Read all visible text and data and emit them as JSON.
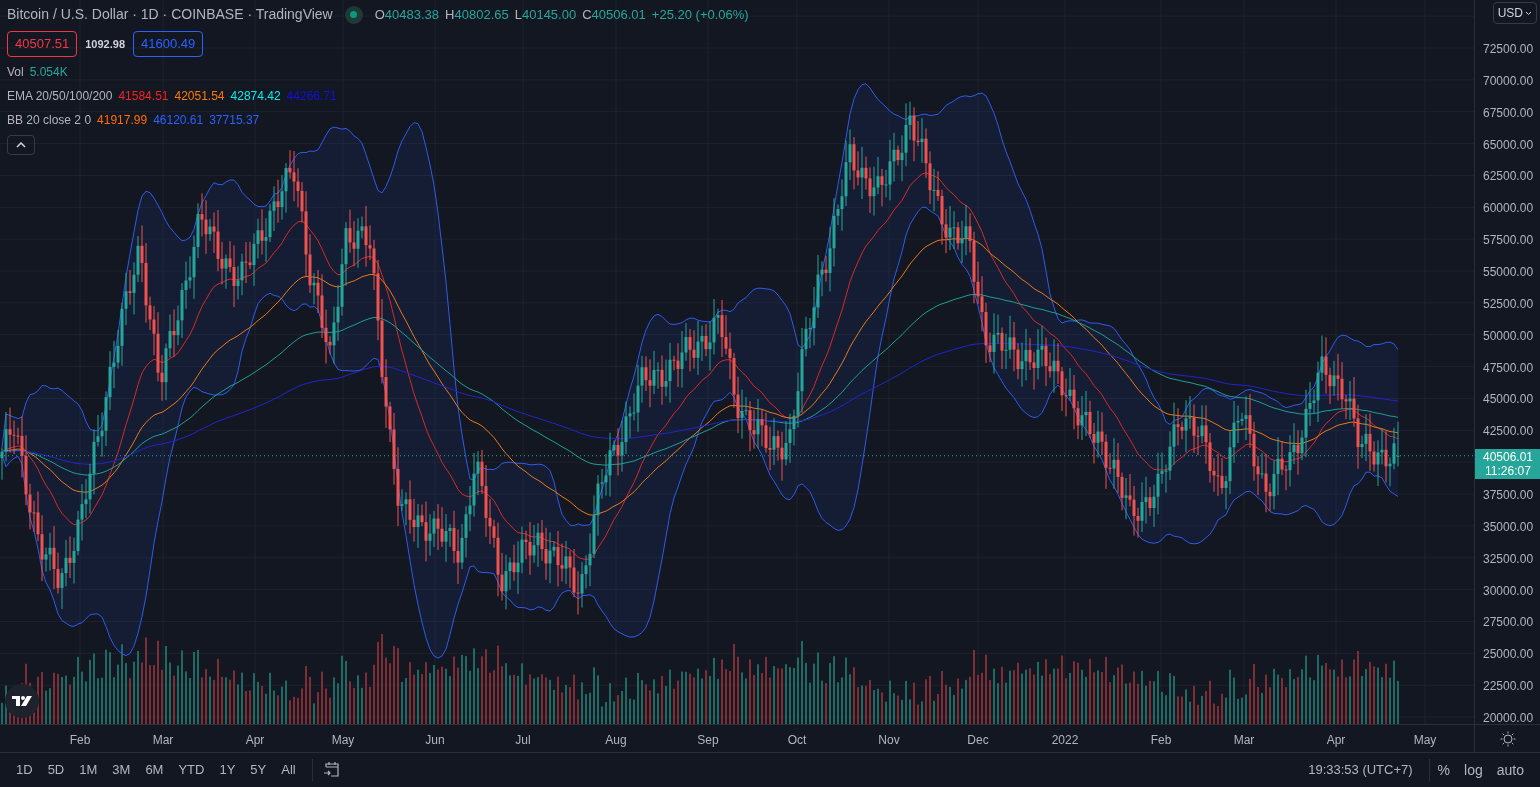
{
  "header": {
    "title": "Bitcoin / U.S. Dollar · 1D · COINBASE · TradingView",
    "ohlc": [
      {
        "label": "O",
        "value": "40483.38"
      },
      {
        "label": "H",
        "value": "40802.65"
      },
      {
        "label": "L",
        "value": "40145.00"
      },
      {
        "label": "C",
        "value": "40506.01"
      }
    ],
    "change": "+25.20 (+0.06%)"
  },
  "quote": {
    "sell": "40507.51",
    "spread": "1092.98",
    "buy": "41600.49"
  },
  "indicators": [
    {
      "name": "Vol",
      "values": [
        {
          "text": "5.054K",
          "color": "#26a69a"
        }
      ]
    },
    {
      "name": "EMA 20/50/100/200",
      "values": [
        {
          "text": "41584.51",
          "color": "#f7211e"
        },
        {
          "text": "42051.54",
          "color": "#ff7a00"
        },
        {
          "text": "42874.42",
          "color": "#00f0f0"
        },
        {
          "text": "44266.71",
          "color": "#1010e0"
        }
      ]
    },
    {
      "name": "BB 20 close 2 0",
      "values": [
        {
          "text": "41917.99",
          "color": "#ff6d00"
        },
        {
          "text": "46120.61",
          "color": "#2962ff"
        },
        {
          "text": "37715.37",
          "color": "#2962ff"
        }
      ]
    }
  ],
  "currency": "USD",
  "price_axis": {
    "labels": [
      "72500.00",
      "70000.00",
      "67500.00",
      "65000.00",
      "62500.00",
      "60000.00",
      "57500.00",
      "55000.00",
      "52500.00",
      "50000.00",
      "47500.00",
      "45000.00",
      "42500.00",
      "37500.00",
      "35000.00",
      "32500.00",
      "30000.00",
      "27500.00",
      "25000.00",
      "22500.00",
      "20000.00"
    ],
    "last_price": "40506.01",
    "countdown": "11:26:07"
  },
  "time_axis": [
    "Feb",
    "Mar",
    "Apr",
    "May",
    "Jun",
    "Jul",
    "Aug",
    "Sep",
    "Oct",
    "Nov",
    "Dec",
    "2022",
    "Feb",
    "Mar",
    "Apr",
    "May"
  ],
  "ranges": [
    "1D",
    "5D",
    "1M",
    "3M",
    "6M",
    "YTD",
    "1Y",
    "5Y",
    "All"
  ],
  "status": {
    "clock": "19:33:53 (UTC+7)",
    "scale_options": [
      "%",
      "log",
      "auto"
    ]
  }
}
